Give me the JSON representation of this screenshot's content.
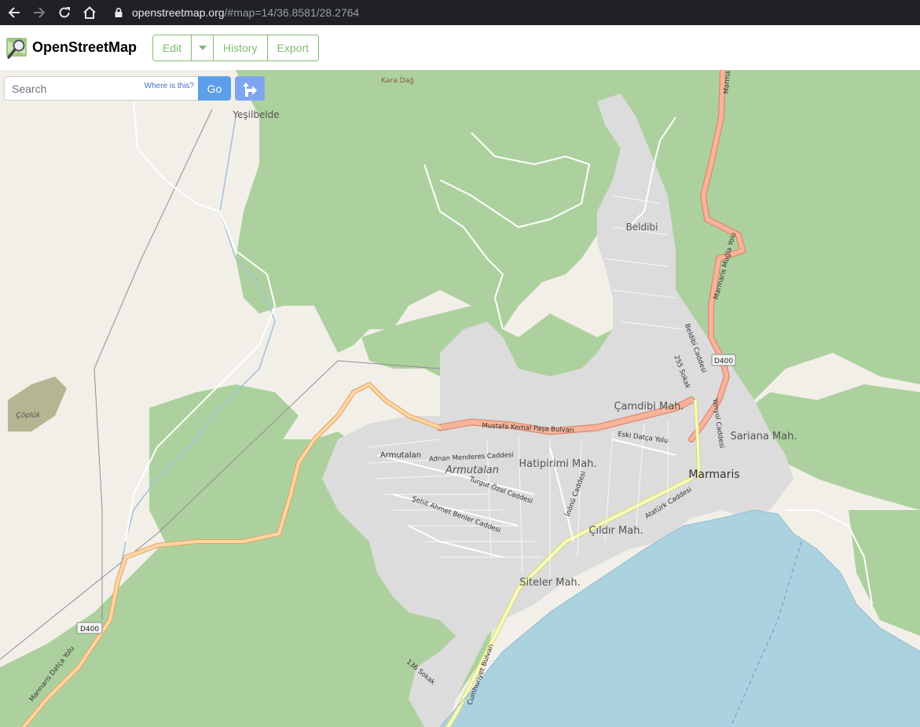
{
  "browser": {
    "url_host": "openstreetmap.org",
    "url_path": "/#map=14/36.8581/28.2764"
  },
  "header": {
    "brand": "OpenStreetMap",
    "buttons": {
      "edit": "Edit",
      "history": "History",
      "export": "Export"
    }
  },
  "search": {
    "placeholder": "Search",
    "where_is_this": "Where is this?",
    "go": "Go"
  },
  "map": {
    "places": {
      "kara_dag": "Kara Dağ",
      "yesilbelde": "Yeşilbelde",
      "coplluk": "Çöplük",
      "beldibi": "Beldibi",
      "camdibi": "Çamdibi Mah.",
      "sariana": "Sariana Mah.",
      "marmaris": "Marmaris",
      "armutalan_district": "Armutalan",
      "armutalan_small": "Armutalan",
      "hatipirimi": "Hatipirimi Mah.",
      "cildir": "Çıldır Mah.",
      "siteler": "Siteler Mah."
    },
    "roads": {
      "mustafa_kemal": "Mustafa Kemal Paşa Bulvarı",
      "adnan_menderes": "Adnan Menderes Caddesi",
      "turgut_ozal": "Turgut Özal Caddesi",
      "sehit_ahmet": "Şehit Ahmet Benler Caddesi",
      "inonu": "İnönü Caddesi",
      "ataturk": "Atatürk Caddesi",
      "eski_datca": "Eski Datça Yolu",
      "beldibi_caddesi": "Beldibi Caddesi",
      "sokak_255": "255 Sokak",
      "yenyol": "Yenyol Caddesi",
      "marmaris_mugla": "Marmaris Muğla Yolu",
      "marmaris_datca": "Marmaris Datça Yolu",
      "cumhuriyet": "Cumhuriyet Bulvarı",
      "sokak_136": "136 Sokak",
      "marma": "Marma"
    },
    "shields": {
      "d400_a": "D400",
      "d400_b": "D400"
    },
    "colors": {
      "land": "#f2efe9",
      "forest": "#add19e",
      "urban": "#dddddd",
      "water": "#aad3df",
      "primary_road": "#f7b49a",
      "trunk_road": "#e89f87",
      "secondary_road": "#fcd6a4",
      "tertiary_road": "#f7fabf"
    }
  }
}
